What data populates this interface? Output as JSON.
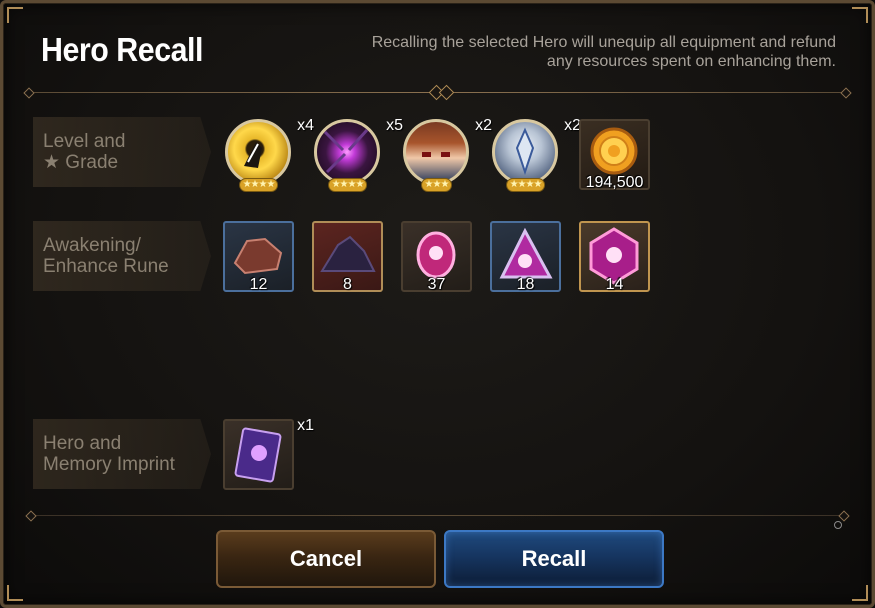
{
  "title": "Hero Recall",
  "subtitle": "Recalling the selected Hero will unequip all equipment and refund any resources spent on enhancing them.",
  "rows": [
    {
      "label_line1": "Level and",
      "label_line2": "★ Grade",
      "heroes": [
        {
          "icon": "golden-feather-hero-icon",
          "stars": "★★★★",
          "mult": "x4"
        },
        {
          "icon": "purple-orb-hero-icon",
          "stars": "★★★★",
          "mult": "x5"
        },
        {
          "icon": "brown-hair-hero-icon",
          "stars": "★★★",
          "mult": "x2"
        },
        {
          "icon": "silver-knight-hero-icon",
          "stars": "★★★★",
          "mult": "x2"
        }
      ],
      "gold": {
        "icon": "gold-coin-icon",
        "qty": "194,500"
      }
    },
    {
      "label_line1": "Awakening/",
      "label_line2": "Enhance Rune",
      "items": [
        {
          "icon": "red-ore-icon",
          "qty": "12",
          "frame": "blue"
        },
        {
          "icon": "dark-ore-icon",
          "qty": "8",
          "frame": "red"
        },
        {
          "icon": "pink-rune-oval-icon",
          "qty": "37",
          "frame": "plain"
        },
        {
          "icon": "pink-rune-triangle-icon",
          "qty": "18",
          "frame": "blue"
        },
        {
          "icon": "pink-rune-hexagon-icon",
          "qty": "14",
          "frame": "gold"
        }
      ]
    },
    {
      "label_line1": "Hero and",
      "label_line2": "Memory Imprint",
      "items": [
        {
          "icon": "memory-imprint-book-icon",
          "mult": "x1"
        }
      ]
    }
  ],
  "buttons": {
    "cancel": "Cancel",
    "recall": "Recall"
  },
  "colors": {
    "accent_gold": "#b08d57",
    "recall_blue": "#1f4a7e",
    "cancel_brown": "#5a3c1d"
  }
}
